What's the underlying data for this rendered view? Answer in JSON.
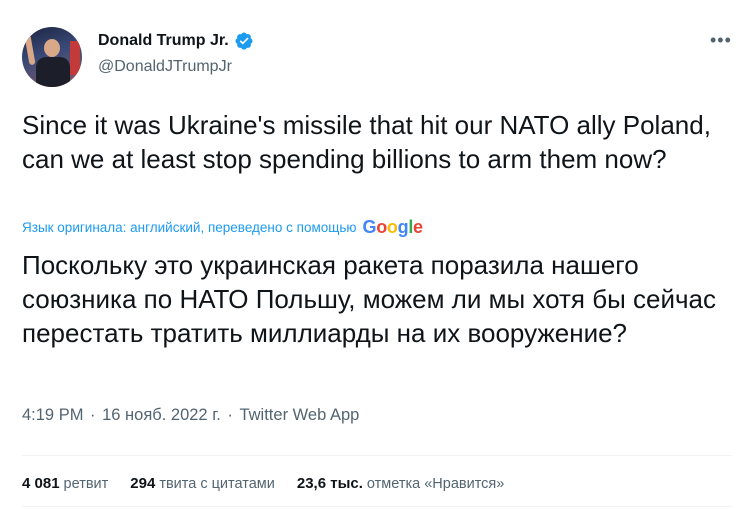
{
  "author": {
    "name": "Donald Trump Jr.",
    "handle": "@DonaldJTrumpJr",
    "verified": true,
    "verified_color": "#1d9bf0"
  },
  "more_icon": "more-dots-icon",
  "tweet": {
    "text": "Since it was Ukraine's missile that hit our NATO ally Poland, can we at least stop spending billions to arm them now?",
    "translation_label": "Язык оригинала: английский, переведено с помощью",
    "translation_provider": [
      "G",
      "o",
      "o",
      "g",
      "l",
      "e"
    ],
    "translated_text": "Поскольку это украинская ракета поразила нашего союзника по НАТО Польшу, можем ли мы хотя бы сейчас перестать тратить миллиарды на их вооружение?"
  },
  "meta": {
    "time": "4:19 PM",
    "sep1": " · ",
    "date": "16 нояб. 2022 г.",
    "sep2": " · ",
    "source": "Twitter Web App"
  },
  "stats": [
    {
      "count": "4 081",
      "label": "ретвит"
    },
    {
      "count": "294",
      "label": "твита с цитатами"
    },
    {
      "count": "23,6 тыс.",
      "label": "отметка «Нравится»"
    }
  ]
}
